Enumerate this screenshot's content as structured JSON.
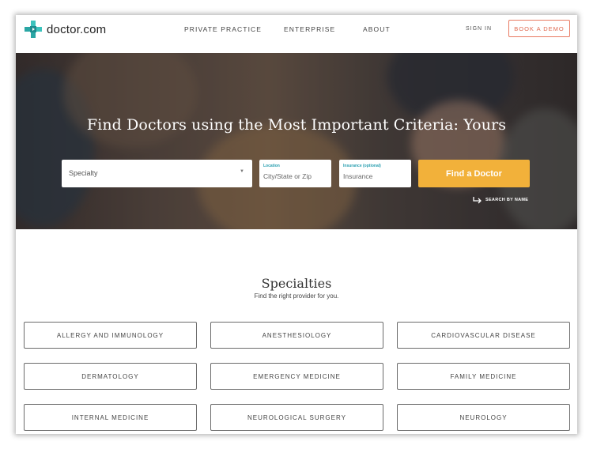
{
  "header": {
    "logo_text": "doctor.com",
    "nav": [
      "PRIVATE PRACTICE",
      "ENTERPRISE",
      "ABOUT"
    ],
    "sign_in": "SIGN IN",
    "book_demo": "BOOK A DEMO"
  },
  "hero": {
    "title": "Find Doctors using the Most Important Criteria: Yours",
    "specialty_placeholder": "Specialty",
    "location_label": "Location",
    "location_placeholder": "City/State or Zip",
    "insurance_label": "Insurance (optional)",
    "insurance_placeholder": "Insurance",
    "find_button": "Find a Doctor",
    "search_by_name": "SEARCH BY NAME"
  },
  "specialties": {
    "title": "Specialties",
    "subtitle": "Find the right provider for you.",
    "items": [
      "ALLERGY AND IMMUNOLOGY",
      "ANESTHESIOLOGY",
      "CARDIOVASCULAR DISEASE",
      "DERMATOLOGY",
      "EMERGENCY MEDICINE",
      "FAMILY MEDICINE",
      "INTERNAL MEDICINE",
      "NEUROLOGICAL SURGERY",
      "NEUROLOGY"
    ]
  },
  "colors": {
    "brand_teal": "#2fb5b0",
    "accent_orange": "#f2b13a",
    "demo_red": "#e06b52"
  }
}
